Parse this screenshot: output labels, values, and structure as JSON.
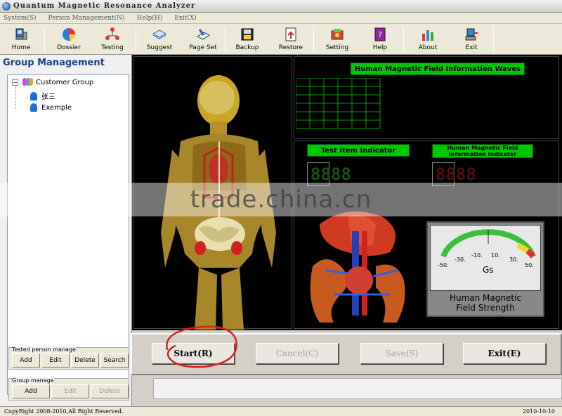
{
  "window": {
    "title": "Quantum Magnetic Resonance Analyzer"
  },
  "menu": [
    "System(S)",
    "Person Management(N)",
    "Help(H)",
    "Exit(X)"
  ],
  "toolbar": [
    {
      "label": "Home",
      "icon": "pc-icon"
    },
    {
      "label": "Dossier",
      "icon": "pie-chart-icon"
    },
    {
      "label": "Testing",
      "icon": "network-icon"
    },
    {
      "label": "Suggest",
      "icon": "book-icon"
    },
    {
      "label": "Page Set",
      "icon": "page-setup-icon"
    },
    {
      "label": "Backup",
      "icon": "backup-disk-icon"
    },
    {
      "label": "Restore",
      "icon": "restore-icon"
    },
    {
      "label": "Setting",
      "icon": "settings-icon"
    },
    {
      "label": "Help",
      "icon": "help-book-icon"
    },
    {
      "label": "About",
      "icon": "bar-chart-icon"
    },
    {
      "label": "Exit",
      "icon": "exit-computer-icon"
    }
  ],
  "sidebar": {
    "title": "Group Management",
    "tree": {
      "root": "Customer Group",
      "children": [
        "张三",
        "Exemple"
      ]
    },
    "tested": {
      "caption": "Tested person manage",
      "buttons": [
        "Add",
        "Edit",
        "Delete",
        "Search"
      ]
    },
    "group": {
      "caption": "Group manage",
      "buttons": [
        "Add",
        "Edit",
        "Delete"
      ]
    }
  },
  "panels": {
    "waves_title": "Human Magnetic Field Information Waves",
    "test_item_title": "Test Item Indicator",
    "info_indicator_title": "Human Magnetic Field Information Indicator",
    "test_item_digits": "8888",
    "info_digits": "8888",
    "meter": {
      "scale": [
        "-50.",
        "-30.",
        "-10.",
        "10.",
        "30.",
        "50."
      ],
      "unit": "Gs",
      "caption_line1": "Human Magnetic",
      "caption_line2": "Field Strength"
    }
  },
  "controls": {
    "start": "Start(R)",
    "cancel": "Cancel(C)",
    "save": "Save(S)",
    "exit": "Exit(E)"
  },
  "status": {
    "copyright": "CopyRight 2008-2010,All Right Reserved.",
    "date": "2010-10-10"
  },
  "watermark": "trade.china.cn",
  "colors": {
    "panel_label": "#00c800",
    "test_led": "#1a4d1a",
    "info_led": "#4d0f0f",
    "title_blue": "#1a3f85",
    "annotation": "#d62020"
  }
}
